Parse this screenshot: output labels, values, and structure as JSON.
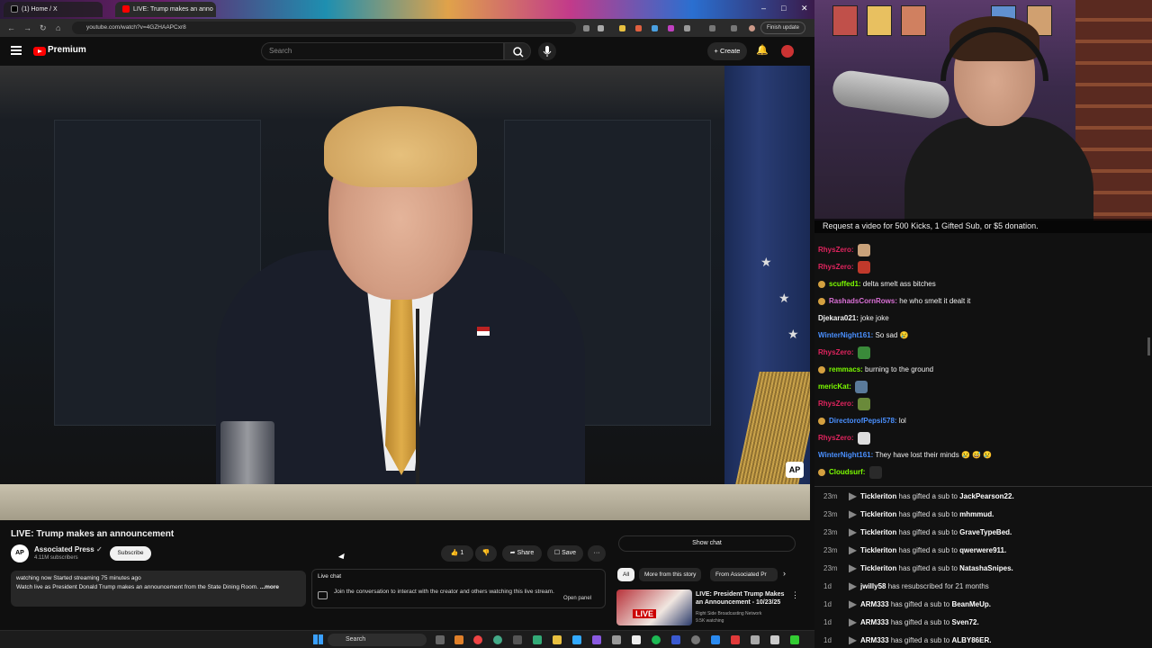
{
  "browser": {
    "tabs": [
      {
        "label": "(1) Home / X"
      },
      {
        "label": "LIVE: Trump makes an anno"
      }
    ],
    "url": "youtube.com/watch?v=4GZHAAPCxr8",
    "finish_update": "Finish update"
  },
  "yt": {
    "brand": "Premium",
    "search_placeholder": "Search",
    "create_label": "Create"
  },
  "video": {
    "title": "LIVE: Trump makes an announcement",
    "watermark": "AP",
    "channel": {
      "name": "Associated Press",
      "avatar_text": "AP",
      "subs": "4.11M subscribers",
      "subscribe_label": "Subscribe"
    },
    "actions": {
      "likes": "1",
      "share": "Share",
      "save": "Save",
      "more": "···"
    },
    "description": {
      "stats": "watching now  Started streaming 75 minutes ago",
      "text": "Watch live as President Donald Trump makes an announcement from the State Dining Room.",
      "more": "...more"
    },
    "live_chat": {
      "label": "Live chat",
      "text": "Join the conversation to interact with the creator and others watching this live stream.",
      "open_panel": "Open panel"
    }
  },
  "sidebar": {
    "show_chat": "Show chat",
    "chips": [
      "All",
      "More from this story",
      "From Associated Pr"
    ],
    "rec": {
      "badge": "LIVE",
      "title": "LIVE: President Trump Makes an Announcement - 10/23/25",
      "channel": "Right Side Broadcasting Network",
      "views": "9.5K watching"
    }
  },
  "stream": {
    "banner": "Request a video for 500 Kicks, 1 Gifted Sub, or $5 donation.",
    "chat": [
      {
        "user": "RhysZero:",
        "text": "",
        "user_color": "#e0245e",
        "badge": false,
        "emote": "#c9a27a"
      },
      {
        "user": "RhysZero:",
        "text": "",
        "user_color": "#e0245e",
        "badge": false,
        "emote": "#c0392b"
      },
      {
        "user": "scuffed1:",
        "text": "delta smelt ass bitches",
        "user_color": "#7CFC00",
        "badge": true,
        "emote": ""
      },
      {
        "user": "RashadsCornRows:",
        "text": "he who smelt it dealt it",
        "user_color": "#da70d6",
        "badge": true,
        "emote": ""
      },
      {
        "user": "Djekara021:",
        "text": "joke joke",
        "user_color": "#f1f1f1",
        "badge": false,
        "emote": ""
      },
      {
        "user": "WinterNight161:",
        "text": "So sad 😢",
        "user_color": "#4a90ff",
        "badge": false,
        "emote": ""
      },
      {
        "user": "RhysZero:",
        "text": "",
        "user_color": "#e0245e",
        "badge": false,
        "emote": "#3a8a3a"
      },
      {
        "user": "remmacs:",
        "text": "burning to the ground",
        "user_color": "#7CFC00",
        "badge": true,
        "emote": ""
      },
      {
        "user": "mericKat:",
        "text": "",
        "user_color": "#7CFC00",
        "badge": false,
        "emote": "#5a7a9a"
      },
      {
        "user": "RhysZero:",
        "text": "",
        "user_color": "#e0245e",
        "badge": false,
        "emote": "#6a8a3a"
      },
      {
        "user": "DirectorofPepsi578:",
        "text": "lol",
        "user_color": "#4a90ff",
        "badge": true,
        "emote": ""
      },
      {
        "user": "RhysZero:",
        "text": "",
        "user_color": "#e0245e",
        "badge": false,
        "emote": "#dddddd"
      },
      {
        "user": "WinterNight161:",
        "text": "They have lost their minds 😢 😅 😢",
        "user_color": "#4a90ff",
        "badge": false,
        "emote": ""
      },
      {
        "user": "Cloudsurf:",
        "text": "",
        "user_color": "#7CFC00",
        "badge": true,
        "emote": "#2a2a2a"
      }
    ],
    "events": [
      {
        "time": "23m",
        "who": "Tickleriton",
        "action": "has gifted a sub to",
        "target": "JackPearson22."
      },
      {
        "time": "23m",
        "who": "Tickleriton",
        "action": "has gifted a sub to",
        "target": "mhmmud."
      },
      {
        "time": "23m",
        "who": "Tickleriton",
        "action": "has gifted a sub to",
        "target": "GraveTypeBed."
      },
      {
        "time": "23m",
        "who": "Tickleriton",
        "action": "has gifted a sub to",
        "target": "qwerwere911."
      },
      {
        "time": "23m",
        "who": "Tickleriton",
        "action": "has gifted a sub to",
        "target": "NatashaSnipes."
      },
      {
        "time": "1d",
        "who": "jwilly58",
        "action": "has resubscribed for 21 months",
        "target": ""
      },
      {
        "time": "1d",
        "who": "ARM333",
        "action": "has gifted a sub to",
        "target": "BeanMeUp."
      },
      {
        "time": "1d",
        "who": "ARM333",
        "action": "has gifted a sub to",
        "target": "Sven72."
      },
      {
        "time": "1d",
        "who": "ARM333",
        "action": "has gifted a sub to",
        "target": "ALBY86ER."
      }
    ]
  },
  "taskbar": {
    "search": "Search"
  }
}
